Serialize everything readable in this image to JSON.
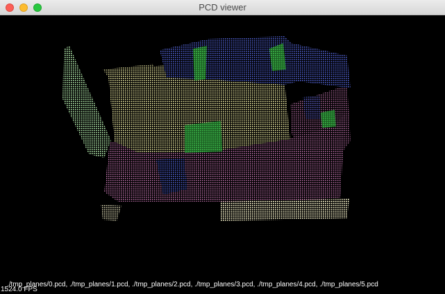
{
  "window": {
    "title": "PCD viewer",
    "controls": [
      "close",
      "minimize",
      "zoom"
    ]
  },
  "viewer": {
    "background": "#000000",
    "files_label": "./tmp_planes/0.pcd, ./tmp_planes/1.pcd, ./tmp_planes/2.pcd, ./tmp_planes/3.pcd, ./tmp_planes/4.pcd, ./tmp_planes/5.pcd",
    "fps_label": "1524.0 FPS",
    "cloud_colors": {
      "yellow": "#e8e6a0",
      "green": "#2f9a3a",
      "light_green": "#b8f0b0",
      "blue": "#4a5ac8",
      "pink": "#c878b4",
      "cream": "#f4f0c8"
    }
  }
}
